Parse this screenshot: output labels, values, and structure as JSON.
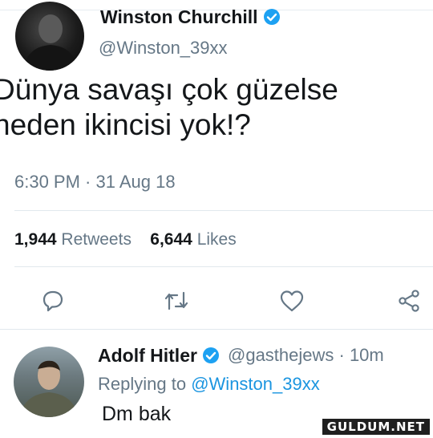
{
  "tweet": {
    "author_name": "Winston Churchill",
    "author_handle": "@Winston_39xx",
    "text_line1": "Dünya savaşı çok güzelse",
    "text_line2": "neden ikincisi yok!?",
    "timestamp": "6:30 PM · 31 Aug 18",
    "retweets_count": "1,944",
    "retweets_label": "Retweets",
    "likes_count": "6,644",
    "likes_label": "Likes"
  },
  "actions": {
    "icons": [
      "reply-icon",
      "retweet-icon",
      "like-icon",
      "share-icon"
    ]
  },
  "reply": {
    "author_name": "Adolf Hitler",
    "author_handle": "@gasthejews · 10m",
    "replying_prefix": "Replying to",
    "replying_mention": "@Winston_39xx",
    "text": "Dm bak"
  },
  "watermark": "GULDUM.NET",
  "colors": {
    "verified": "#1da1f2",
    "mention": "#1b95e0",
    "muted_text": "#657786",
    "icon": "#657786"
  }
}
